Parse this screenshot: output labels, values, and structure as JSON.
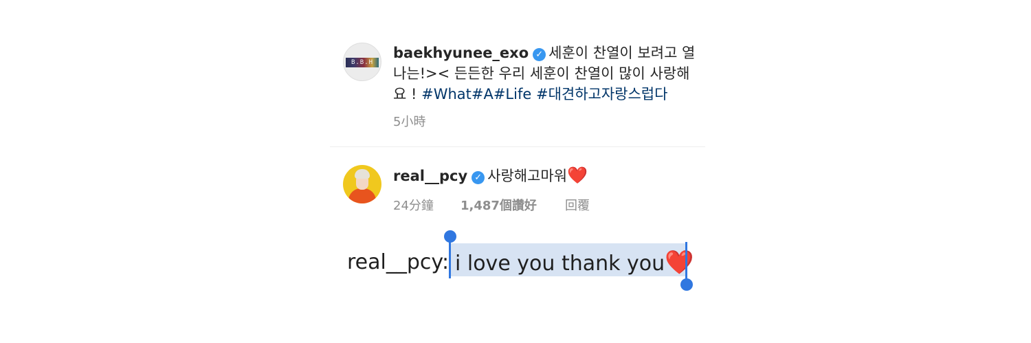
{
  "post": {
    "username": "baekhyunee_exo",
    "verified_glyph": "✓",
    "avatar_label": "B.B.H",
    "caption_line1": "세훈이 찬열이 보려고 열",
    "caption_line2": "나는!>< 든든한 우리 세훈이 찬열이 많이 사랑해",
    "caption_line3_prefix": "요 ! ",
    "hashtag1": "#What#A#Life",
    "hashtag2": "#대견하고자랑스럽다",
    "time": "5小時"
  },
  "comment": {
    "username": "real__pcy",
    "verified_glyph": "✓",
    "text": "사랑해고마워",
    "heart": "❤️",
    "time": "24分鐘",
    "likes": "1,487個讚好",
    "reply": "回覆"
  },
  "translation": {
    "prefix": "real__pcy:",
    "selected_text": "i love you thank you",
    "heart": "❤️"
  },
  "colors": {
    "hashtag": "#003569",
    "verified": "#3897f0",
    "selection": "#d7e3f3",
    "handle": "#3077e0"
  }
}
